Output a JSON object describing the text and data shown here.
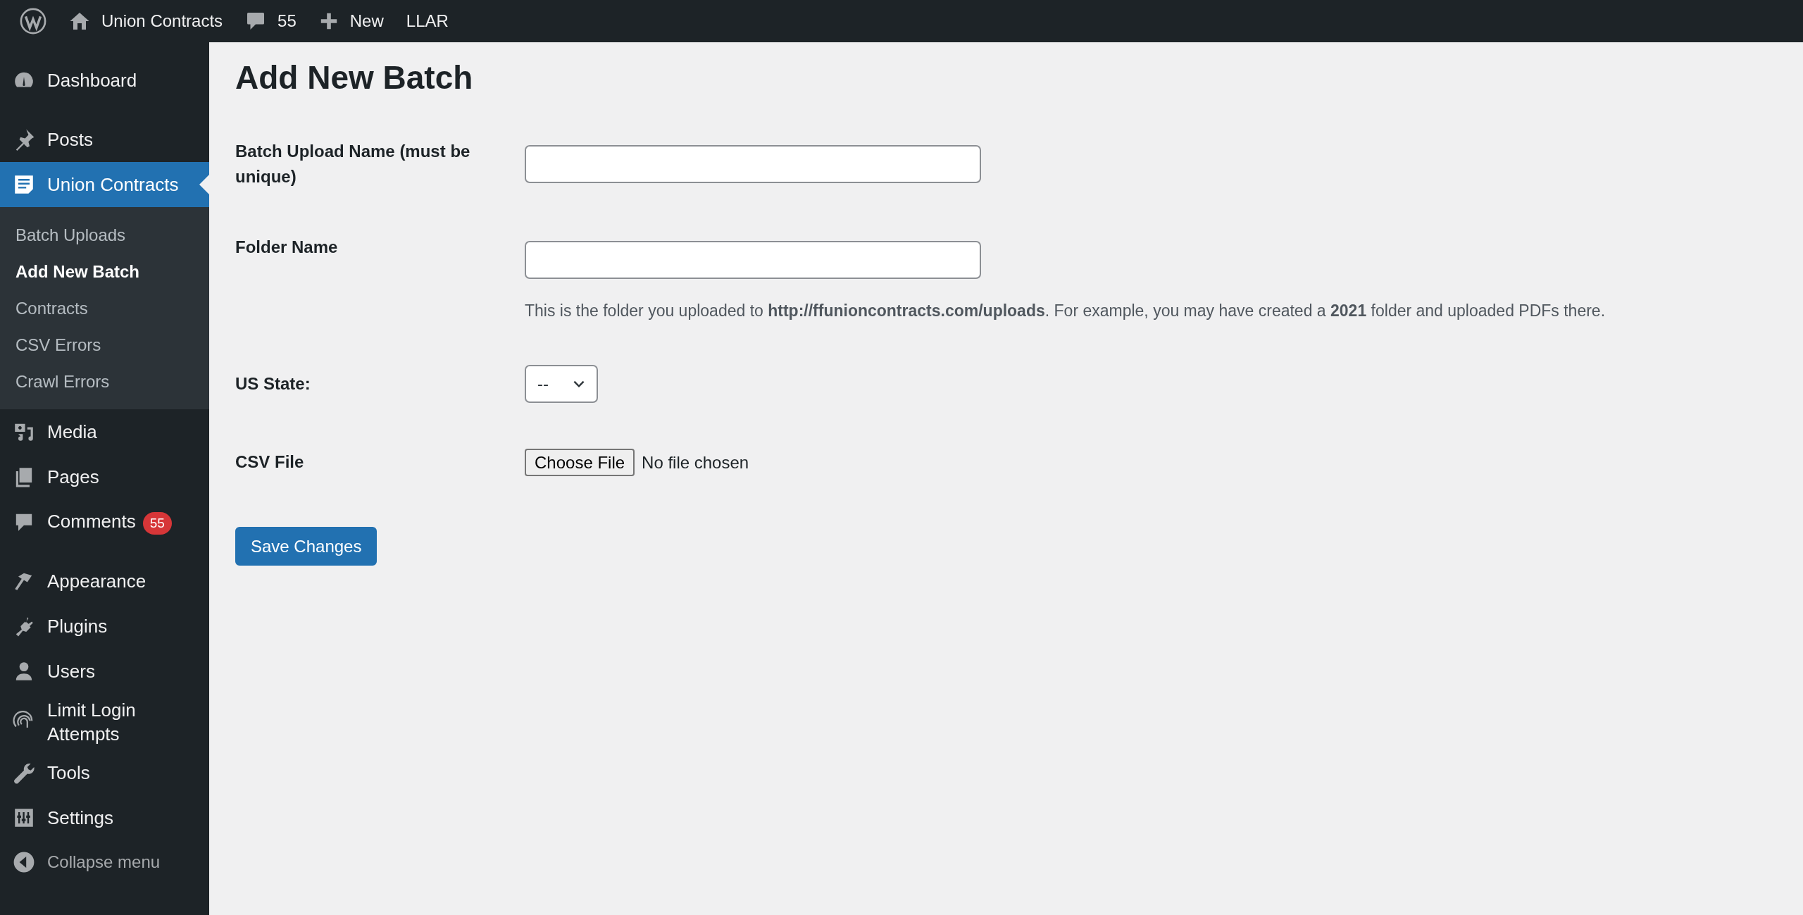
{
  "admin_bar": {
    "site_name": "Union Contracts",
    "comments_count": "55",
    "new_label": "New",
    "plugin_label": "LLAR"
  },
  "sidebar": {
    "groups": [
      [
        {
          "label": "Dashboard",
          "selected": false
        }
      ],
      [
        {
          "label": "Posts",
          "selected": false
        },
        {
          "label": "Union Contracts",
          "selected": true,
          "children": [
            {
              "label": "Batch Uploads",
              "selected": false
            },
            {
              "label": "Add New Batch",
              "selected": true
            },
            {
              "label": "Contracts",
              "selected": false
            },
            {
              "label": "CSV Errors",
              "selected": false
            },
            {
              "label": "Crawl Errors",
              "selected": false
            }
          ]
        },
        {
          "label": "Media",
          "selected": false
        },
        {
          "label": "Pages",
          "selected": false
        },
        {
          "label": "Comments",
          "selected": false,
          "badge": "55"
        }
      ],
      [
        {
          "label": "Appearance",
          "selected": false
        },
        {
          "label": "Plugins",
          "selected": false
        },
        {
          "label": "Users",
          "selected": false
        },
        {
          "label": "Limit Login Attempts",
          "selected": false
        },
        {
          "label": "Tools",
          "selected": false
        },
        {
          "label": "Settings",
          "selected": false
        }
      ]
    ],
    "collapse_label": "Collapse menu"
  },
  "page": {
    "title": "Add New Batch",
    "fields": [
      {
        "kind": "text",
        "label": "Batch Upload Name (must be unique)"
      },
      {
        "kind": "text",
        "label": "Folder Name",
        "description": "This is the folder you uploaded to **http://ffunioncontracts.com/uploads**. For example, you may have created a **2021** folder and uploaded PDFs there."
      },
      {
        "kind": "select",
        "label": "US State:",
        "value": "--"
      },
      {
        "kind": "file",
        "label": "CSV File",
        "button": "Choose File",
        "status": "No file chosen"
      }
    ],
    "submit": "Save Changes"
  }
}
